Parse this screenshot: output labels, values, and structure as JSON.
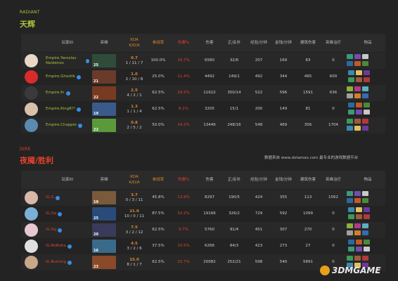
{
  "colors": {
    "radiant": "#a8c23a",
    "dire": "#e3422b",
    "highlight_kda": "#d88a2b",
    "highlight_red": "#e3422b",
    "dire_name": "#e3422b",
    "radiant_name": "#a8c23a"
  },
  "radiant": {
    "tag": "RADIANT",
    "name": "天辉"
  },
  "dire": {
    "tag": "DIRE",
    "name": "夜魇/胜利"
  },
  "source_note": "数据来自 www.dotamax.com 最专业的游戏数据平台",
  "watermark": "3DMGAME",
  "headers": {
    "player": "玩家ID",
    "hero": "英雄",
    "kda": "KDA",
    "kda_sub": "K/D/A",
    "participation": "参战率",
    "damage_pct": "伤害%",
    "damage": "伤害",
    "lh_dn": "正/反补",
    "xpm": "经验/分钟",
    "gpm": "金钱/分钟",
    "building": "建筑伤害",
    "heal": "英雄治疗",
    "items": "物品"
  },
  "radiant_rows": [
    {
      "player": "Empire.Yaroslav Naidenov",
      "hero_lvl": "25",
      "kda": "0.7",
      "kda_detail": "1 / 11 / 7",
      "participation": "100.0%",
      "damage_pct": "16.7%",
      "damage": "6580",
      "lh_dn": "32/6",
      "xpm": "207",
      "gpm": "169",
      "building": "83",
      "heal": "0",
      "avatar_color": "#e9d7c7",
      "hero_color": "#2f4c3a"
    },
    {
      "player": "Empire.Ghostik",
      "hero_lvl": "21",
      "kda": "1.0",
      "kda_detail": "2 / 10 / 8",
      "participation": "25.0%",
      "damage_pct": "11.4%",
      "damage": "4492",
      "lh_dn": "149/1",
      "xpm": "492",
      "gpm": "344",
      "building": "465",
      "heal": "600",
      "avatar_color": "#d92b2b",
      "hero_color": "#6a3a2a"
    },
    {
      "player": "Empire.fn",
      "hero_lvl": "22",
      "kda": "2.5",
      "kda_detail": "4 / 2 / 1",
      "participation": "62.5%",
      "damage_pct": "29.5%",
      "damage": "11622",
      "lh_dn": "350/14",
      "xpm": "522",
      "gpm": "596",
      "building": "1591",
      "heal": "636",
      "avatar_color": "#3a3a3a",
      "hero_color": "#7a3a22"
    },
    {
      "player": "Empire.KingR?!",
      "hero_lvl": "19",
      "kda": "1.3",
      "kda_detail": "1 / 1 / 4",
      "participation": "62.5%",
      "damage_pct": "8.1%",
      "damage": "3205",
      "lh_dn": "15/1",
      "xpm": "200",
      "gpm": "149",
      "building": "81",
      "heal": "0",
      "avatar_color": "#d8c0aa",
      "hero_color": "#3a5a8a"
    },
    {
      "player": "Empire.Chappie",
      "hero_lvl": "22",
      "kda": "0.8",
      "kda_detail": "2 / 5 / 2",
      "participation": "50.0%",
      "damage_pct": "34.2%",
      "damage": "13446",
      "lh_dn": "248/16",
      "xpm": "548",
      "gpm": "469",
      "building": "356",
      "heal": "1704",
      "avatar_color": "#5a8ab0",
      "hero_color": "#5a9a3a"
    }
  ],
  "dire_rows": [
    {
      "player": "iG.G",
      "hero_lvl": "19",
      "kda": "3.7",
      "kda_detail": "0 / 3 / 11",
      "participation": "45.8%",
      "damage_pct": "13.9%",
      "damage": "8297",
      "lh_dn": "190/5",
      "xpm": "424",
      "gpm": "355",
      "building": "113",
      "heal": "1562",
      "avatar_color": "#d8b8a8",
      "hero_color": "#7a5a3a"
    },
    {
      "player": "iG.Op",
      "hero_lvl": "25",
      "kda": "21.0",
      "kda_detail": "10 / 0 / 11",
      "participation": "87.5%",
      "damage_pct": "32.2%",
      "damage": "19166",
      "lh_dn": "326/2",
      "xpm": "729",
      "gpm": "592",
      "building": "1099",
      "heal": "0",
      "avatar_color": "#7ab0d8",
      "hero_color": "#2a4a7a"
    },
    {
      "player": "iG.Ssj",
      "hero_lvl": "20",
      "kda": "7.5",
      "kda_detail": "3 / 2 / 12",
      "participation": "62.5%",
      "damage_pct": "9.7%",
      "damage": "5760",
      "lh_dn": "91/4",
      "xpm": "451",
      "gpm": "307",
      "building": "270",
      "heal": "0",
      "avatar_color": "#e8c8d0",
      "hero_color": "#3a3a5a"
    },
    {
      "player": "iG.BoBoKa",
      "hero_lvl": "16",
      "kda": "4.5",
      "kda_detail": "3 / 2 / 6",
      "participation": "37.5%",
      "damage_pct": "10.5%",
      "damage": "6266",
      "lh_dn": "84/3",
      "xpm": "423",
      "gpm": "273",
      "building": "27",
      "heal": "0",
      "avatar_color": "#e0e0e0",
      "hero_color": "#3a6a8a"
    },
    {
      "player": "iG.Burning",
      "hero_lvl": "23",
      "kda": "15.0",
      "kda_detail": "8 / 1 / 7",
      "participation": "62.5%",
      "damage_pct": "33.7%",
      "damage": "20082",
      "lh_dn": "252/21",
      "xpm": "598",
      "gpm": "540",
      "building": "5891",
      "heal": "0",
      "avatar_color": "#c8a888",
      "hero_color": "#8a4a2a"
    }
  ]
}
